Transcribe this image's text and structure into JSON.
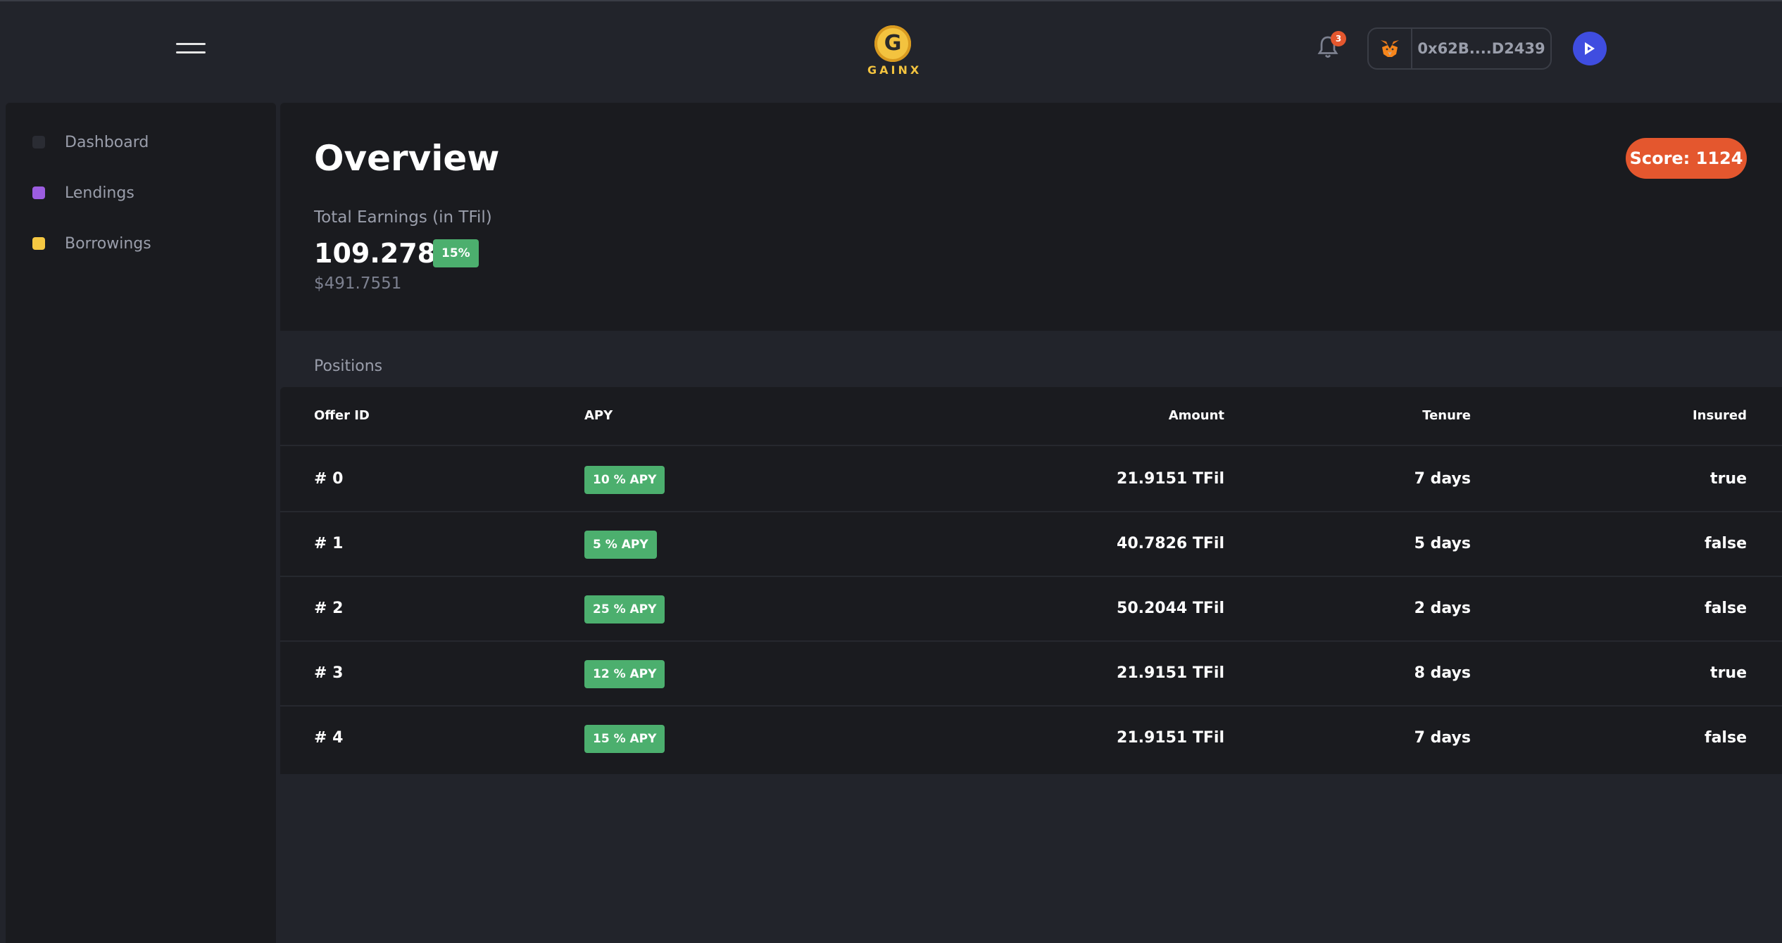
{
  "header": {
    "logo_text": "GAINX",
    "notification_count": "3",
    "wallet_address": "0x62B....D2439"
  },
  "sidebar": {
    "items": [
      {
        "label": "Dashboard",
        "color": "#2a2c33"
      },
      {
        "label": "Lendings",
        "color": "#9c5de0"
      },
      {
        "label": "Borrowings",
        "color": "#f5c842"
      }
    ]
  },
  "overview": {
    "title": "Overview",
    "score_label": "Score: 1124",
    "earnings_label": "Total Earnings (in TFil)",
    "earnings_value": "109.2789",
    "earnings_badge": "15%",
    "earnings_usd": "$491.7551"
  },
  "positions": {
    "label": "Positions",
    "columns": [
      "Offer ID",
      "APY",
      "Amount",
      "Tenure",
      "Insured"
    ],
    "rows": [
      {
        "id": "# 0",
        "apy": "10 % APY",
        "amount": "21.9151 TFil",
        "tenure": "7 days",
        "insured": "true"
      },
      {
        "id": "# 1",
        "apy": "5 % APY",
        "amount": "40.7826 TFil",
        "tenure": "5 days",
        "insured": "false"
      },
      {
        "id": "# 2",
        "apy": "25 % APY",
        "amount": "50.2044 TFil",
        "tenure": "2 days",
        "insured": "false"
      },
      {
        "id": "# 3",
        "apy": "12 % APY",
        "amount": "21.9151 TFil",
        "tenure": "8 days",
        "insured": "true"
      },
      {
        "id": "# 4",
        "apy": "15 % APY",
        "amount": "21.9151 TFil",
        "tenure": "7 days",
        "insured": "false"
      }
    ]
  },
  "colors": {
    "accent_orange": "#e4572e",
    "apy_green": "#4caf6e",
    "background": "#22242b",
    "panel": "#1a1b1f"
  }
}
